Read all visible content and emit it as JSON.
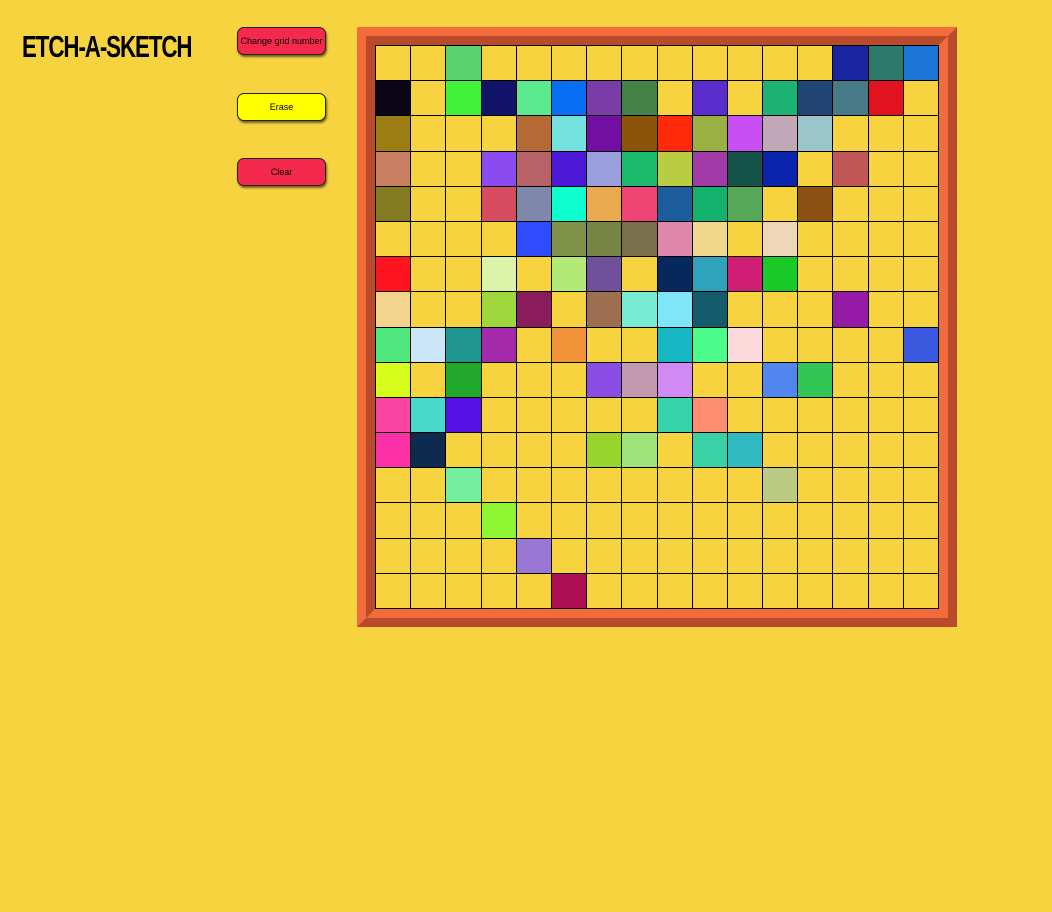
{
  "app": {
    "title": "ETCH-A-SKETCH"
  },
  "controls": {
    "change_grid_label": "Change grid number",
    "erase_label": "Erase",
    "clear_label": "Clear"
  },
  "colors": {
    "background": "#f7d43f",
    "default_cell": "#f7d43f",
    "frame_light": "#f36b3a",
    "frame_dark": "#b94a2b",
    "button_red": "#f5294d",
    "button_yellow": "#ffff00"
  },
  "grid": {
    "size": 16,
    "cells": [
      [
        "",
        "",
        "#5ad36e",
        "",
        "",
        "",
        "",
        "",
        "",
        "",
        "",
        "",
        "",
        "#1a24a0",
        "#2e7a6a",
        "#1b75d6"
      ],
      [
        "#0a0618",
        "",
        "#40f23c",
        "#12146a",
        "#5ce88c",
        "#0a6ef5",
        "#7a3ca6",
        "#458247",
        "",
        "#5b2dcf",
        "",
        "#1bb274",
        "#214575",
        "#457a86",
        "#e21220",
        ""
      ],
      [
        "#9c7d14",
        "",
        "",
        "",
        "#b56a36",
        "#73e2de",
        "#720ea2",
        "#8c540a",
        "#ff2a0a",
        "#9ab043",
        "#c84ff4",
        "#c2a8b6",
        "#99c5cb",
        "",
        "",
        ""
      ],
      [
        "#c97f62",
        "",
        "",
        "#8a4cf1",
        "#b76266",
        "#4c17d7",
        "#9aa0dc",
        "#1abb6a",
        "#b9cd42",
        "#a23aa8",
        "#145348",
        "#0b24b0",
        "",
        "#c05656",
        "",
        ""
      ],
      [
        "#847a22",
        "",
        "",
        "#d84c61",
        "#7f87ab",
        "#0cffcc",
        "#e8a94f",
        "#ee4575",
        "#1c5d9d",
        "#13b36d",
        "#58a85a",
        "",
        "#8c5214",
        "",
        "",
        ""
      ],
      [
        "",
        "",
        "",
        "",
        "#2e4bff",
        "#7f9048",
        "#768544",
        "#78704e",
        "#e086aa",
        "#efd88a",
        "",
        "#f0d6b9",
        "",
        "",
        "",
        ""
      ],
      [
        "#ff1521",
        "",
        "",
        "#dbf4aa",
        "",
        "#b3ea77",
        "#72519c",
        "",
        "#06285c",
        "#2fa3b9",
        "#d11e74",
        "#19c927",
        "",
        "",
        "",
        ""
      ],
      [
        "#f2d48c",
        "",
        "",
        "#9fd63c",
        "#8a1c5c",
        "",
        "#9e6e50",
        "#77ecd3",
        "#7ee6f8",
        "#145c6c",
        "",
        "",
        "",
        "#951ba6",
        "",
        ""
      ],
      [
        "#4ee87e",
        "#cbe6f8",
        "#1f968f",
        "#a22aab",
        "",
        "#f29238",
        "",
        "",
        "#17b6c3",
        "#4cfc8b",
        "#fcdadc",
        "",
        "",
        "",
        "",
        "#3a58dd"
      ],
      [
        "#d6fc1c",
        "",
        "#22a82a",
        "",
        "",
        "",
        "#8a4ee6",
        "#c29ab0",
        "#d18af3",
        "",
        "",
        "#5286ee",
        "#33c656",
        "",
        "",
        ""
      ],
      [
        "#fa46a2",
        "#46d8c8",
        "#5511e2",
        "",
        "",
        "",
        "",
        "",
        "#37d4a9",
        "#ff8d6f",
        "",
        "",
        "",
        "",
        "",
        ""
      ],
      [
        "#fd2fa7",
        "#0e2a4e",
        "",
        "",
        "",
        "",
        "#99d42c",
        "#9ee377",
        "",
        "#38d2a5",
        "#2ebac0",
        "",
        "",
        "",
        "",
        ""
      ],
      [
        "",
        "",
        "#74ee9e",
        "",
        "",
        "",
        "",
        "",
        "",
        "",
        "",
        "#bbcb84",
        "",
        "",
        "",
        ""
      ],
      [
        "",
        "",
        "",
        "#8ff632",
        "",
        "",
        "",
        "",
        "",
        "",
        "",
        "",
        "",
        "",
        "",
        ""
      ],
      [
        "",
        "",
        "",
        "",
        "#9a76d5",
        "",
        "",
        "",
        "",
        "",
        "",
        "",
        "",
        "",
        "",
        ""
      ],
      [
        "",
        "",
        "",
        "",
        "",
        "#ad0e54",
        "",
        "",
        "",
        "",
        "",
        "",
        "",
        "",
        "",
        ""
      ]
    ]
  }
}
